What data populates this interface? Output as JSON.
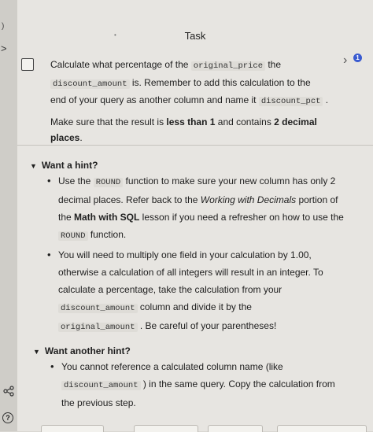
{
  "rail": {
    "arrow": ">",
    "mark": ")"
  },
  "task": {
    "title": "Task",
    "badge": "1",
    "line1_a": "Calculate what percentage of the ",
    "line1_code": "original_price",
    "line1_b": " the",
    "line2_code": "discount_amount",
    "line2_b": " is. Remember to add this calculation to the",
    "line3_a": "end of your query as another column and name it ",
    "line3_code": "discount_pct",
    "line3_b": " .",
    "line4_a": "Make sure that the result is ",
    "line4_bold1": "less than 1",
    "line4_b": " and contains ",
    "line4_bold2": "2 decimal",
    "line5_bold": "places",
    "line5_b": "."
  },
  "hint1": {
    "heading": "Want a hint?",
    "b1_l1_a": "Use the ",
    "b1_l1_code": "ROUND",
    "b1_l1_b": " function to make sure your new column has only 2",
    "b1_l2_a": "decimal places. Refer back to the ",
    "b1_l2_i": "Working with Decimals",
    "b1_l2_b": " portion of",
    "b1_l3_a": "the ",
    "b1_l3_bold": "Math with SQL",
    "b1_l3_b": " lesson if you need a refresher on how to use the",
    "b1_l4_code": "ROUND",
    "b1_l4_b": " function.",
    "b2_l1": "You will need to multiply one field in your calculation by 1.00,",
    "b2_l2": "otherwise a calculation of all integers will result in an integer. To",
    "b2_l3": "calculate a percentage, take the calculation from your",
    "b2_l4_code": "discount_amount",
    "b2_l4_b": " column and divide it by the",
    "b2_l5_code": "original_amount",
    "b2_l5_b": " . Be careful of your parentheses!"
  },
  "hint2": {
    "heading": "Want another hint?",
    "b1_l1": "You cannot reference a calculated column name (like",
    "b1_l2_code": "discount_amount",
    "b1_l2_b": " ) in the same query. Copy the calculation from",
    "b1_l3": "the previous step."
  },
  "icons": {
    "share": "share-icon",
    "help": "help-icon",
    "checkbox": "checkbox-icon",
    "chevron": "chevron-right-icon"
  },
  "colors": {
    "badge": "#3a5bd0",
    "panel": "#e7e5e1",
    "code_bg": "#dedcd7"
  }
}
